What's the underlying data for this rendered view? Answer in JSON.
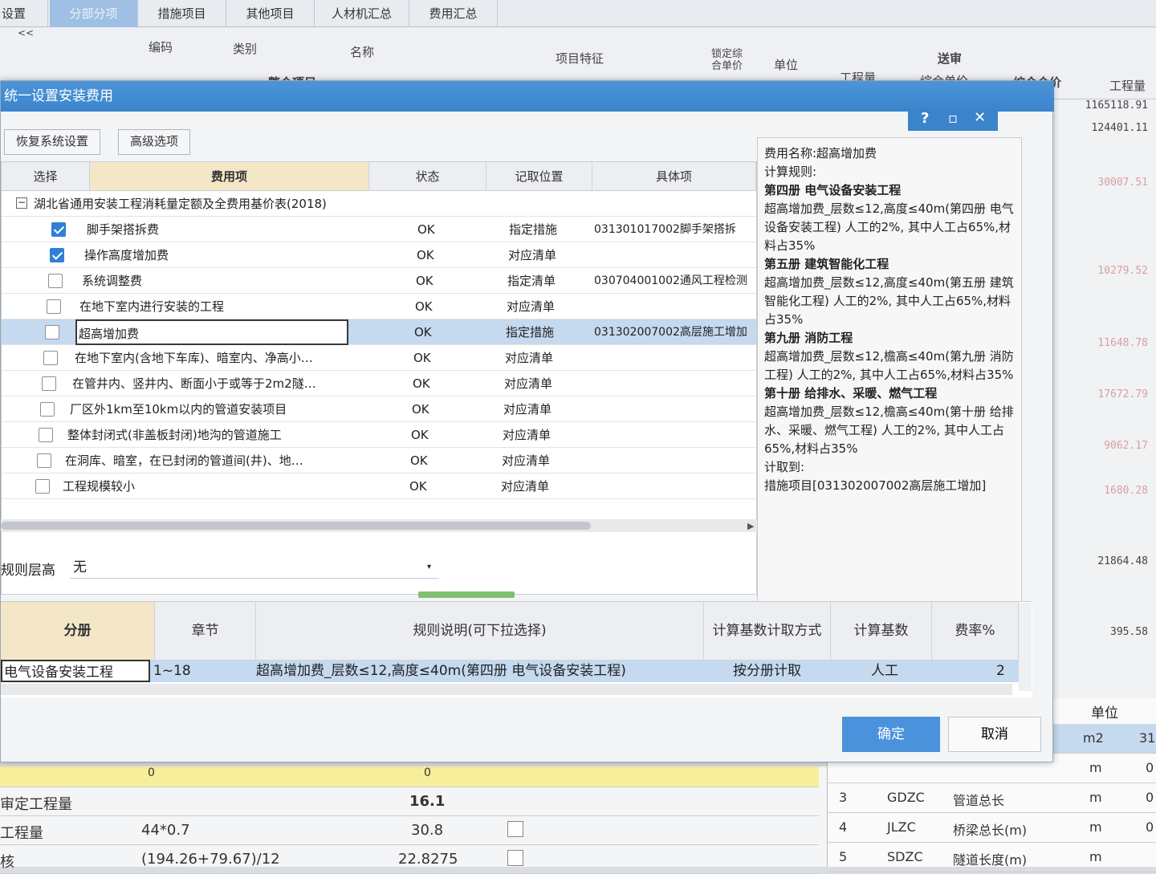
{
  "background": {
    "tabs": [
      "分部分项",
      "措施项目",
      "其他项目",
      "人材机汇总",
      "费用汇总"
    ],
    "left_label": "设置",
    "collapse_label": "<<",
    "headers": {
      "code": "编码",
      "type": "类别",
      "name": "名称",
      "features": "项目特征",
      "locked_price": "锁定综合单价",
      "unit": "单位",
      "review": "送审",
      "quantity": "工程量",
      "unit_price": "综合单价",
      "total_price": "综合合价",
      "quantity2": "工程量"
    },
    "whole_project": "整个项目",
    "right_values": [
      "1165118.91",
      "124401.11",
      "30007.51",
      "10279.52",
      "11648.78",
      "17672.79",
      "9062.17",
      "1680.28",
      "21864.48",
      "395.58"
    ],
    "bottom_right": {
      "unit_header": "单位",
      "rows": [
        {
          "unit": "m2",
          "extra": "31"
        },
        {
          "no": "",
          "code": "",
          "name": "",
          "unit": "m",
          "extra": "0"
        },
        {
          "no": "3",
          "code": "GDZC",
          "name": "管道总长",
          "unit": "m",
          "extra": "0"
        },
        {
          "no": "4",
          "code": "JLZC",
          "name": "桥梁总长(m)",
          "unit": "m",
          "extra": "0"
        },
        {
          "no": "5",
          "code": "SDZC",
          "name": "隧道长度(m)",
          "unit": "m",
          "extra": ""
        }
      ]
    },
    "bottom_left": {
      "rows": [
        {
          "label": "",
          "formula": "0",
          "value": "0"
        },
        {
          "label": "审定工程量",
          "formula": "",
          "value": "16.1"
        },
        {
          "label": "工程量",
          "formula": "44*0.7",
          "value": "30.8"
        },
        {
          "label": "核",
          "formula": "(194.26+79.67)/12",
          "value": "22.8275"
        }
      ]
    }
  },
  "dialog": {
    "title": "统一设置安装费用",
    "help_icon": "?",
    "buttons": {
      "restore": "恢复系统设置",
      "advanced": "高级选项",
      "ok": "确定",
      "cancel": "取消"
    },
    "table": {
      "headers": {
        "select": "选择",
        "fee_item": "费用项",
        "status": "状态",
        "position": "记取位置",
        "detail": "具体项"
      },
      "group": "湖北省通用安装工程消耗量定额及全费用基价表(2018)",
      "rows": [
        {
          "checked": true,
          "name": "脚手架搭拆费",
          "status": "OK",
          "position": "指定措施",
          "detail": "031301017002脚手架搭拆"
        },
        {
          "checked": true,
          "name": "操作高度增加费",
          "status": "OK",
          "position": "对应清单",
          "detail": ""
        },
        {
          "checked": false,
          "name": "系统调整费",
          "status": "OK",
          "position": "指定清单",
          "detail": "030704001002通风工程检测"
        },
        {
          "checked": false,
          "name": "在地下室内进行安装的工程",
          "status": "OK",
          "position": "对应清单",
          "detail": ""
        },
        {
          "checked": false,
          "name": "超高增加费",
          "status": "OK",
          "position": "指定措施",
          "detail": "031302007002高层施工增加",
          "selected": true
        },
        {
          "checked": false,
          "name": "在地下室内(含地下车库)、暗室内、净高小…",
          "status": "OK",
          "position": "对应清单",
          "detail": ""
        },
        {
          "checked": false,
          "name": "在管井内、竖井内、断面小于或等于2m2隧…",
          "status": "OK",
          "position": "对应清单",
          "detail": ""
        },
        {
          "checked": false,
          "name": "厂区外1km至10km以内的管道安装项目",
          "status": "OK",
          "position": "对应清单",
          "detail": ""
        },
        {
          "checked": false,
          "name": "整体封闭式(非盖板封闭)地沟的管道施工",
          "status": "OK",
          "position": "对应清单",
          "detail": ""
        },
        {
          "checked": false,
          "name": "在洞库、暗室，在已封闭的管道间(井)、地…",
          "status": "OK",
          "position": "对应清单",
          "detail": ""
        },
        {
          "checked": false,
          "name": "工程规模较小",
          "status": "OK",
          "position": "对应清单",
          "detail": ""
        }
      ]
    },
    "info": {
      "fee_name": "费用名称:超高增加费",
      "calc_rule": "计算规则:",
      "sections": [
        {
          "title": "第四册 电气设备安装工程",
          "text": "超高增加费_层数≤12,高度≤40m(第四册 电气设备安装工程) 人工的2%, 其中人工占65%,材料占35%"
        },
        {
          "title": "第五册 建筑智能化工程",
          "text": "超高增加费_层数≤12,高度≤40m(第五册 建筑智能化工程) 人工的2%, 其中人工占65%,材料占35%"
        },
        {
          "title": "第九册 消防工程",
          "text": "超高增加费_层数≤12,檐高≤40m(第九册 消防工程) 人工的2%, 其中人工占65%,材料占35%"
        },
        {
          "title": "第十册 给排水、采暖、燃气工程",
          "text": "超高增加费_层数≤12,檐高≤40m(第十册 给排水、采暖、燃气工程) 人工的2%, 其中人工占65%,材料占35%"
        }
      ],
      "calc_to_label": "计取到:",
      "calc_to": "措施项目[031302007002高层施工增加]"
    },
    "rule_floor_label": "规则层高",
    "rule_floor_value": "无",
    "rules": {
      "headers": {
        "volume": "分册",
        "chapter": "章节",
        "desc": "规则说明(可下拉选择)",
        "method": "计算基数计取方式",
        "base": "计算基数",
        "rate": "费率%"
      },
      "row": {
        "volume": "电气设备安装工程",
        "chapter": "1~18",
        "desc": "超高增加费_层数≤12,高度≤40m(第四册 电气设备安装工程)",
        "method": "按分册计取",
        "base": "人工",
        "rate": "2"
      }
    }
  }
}
